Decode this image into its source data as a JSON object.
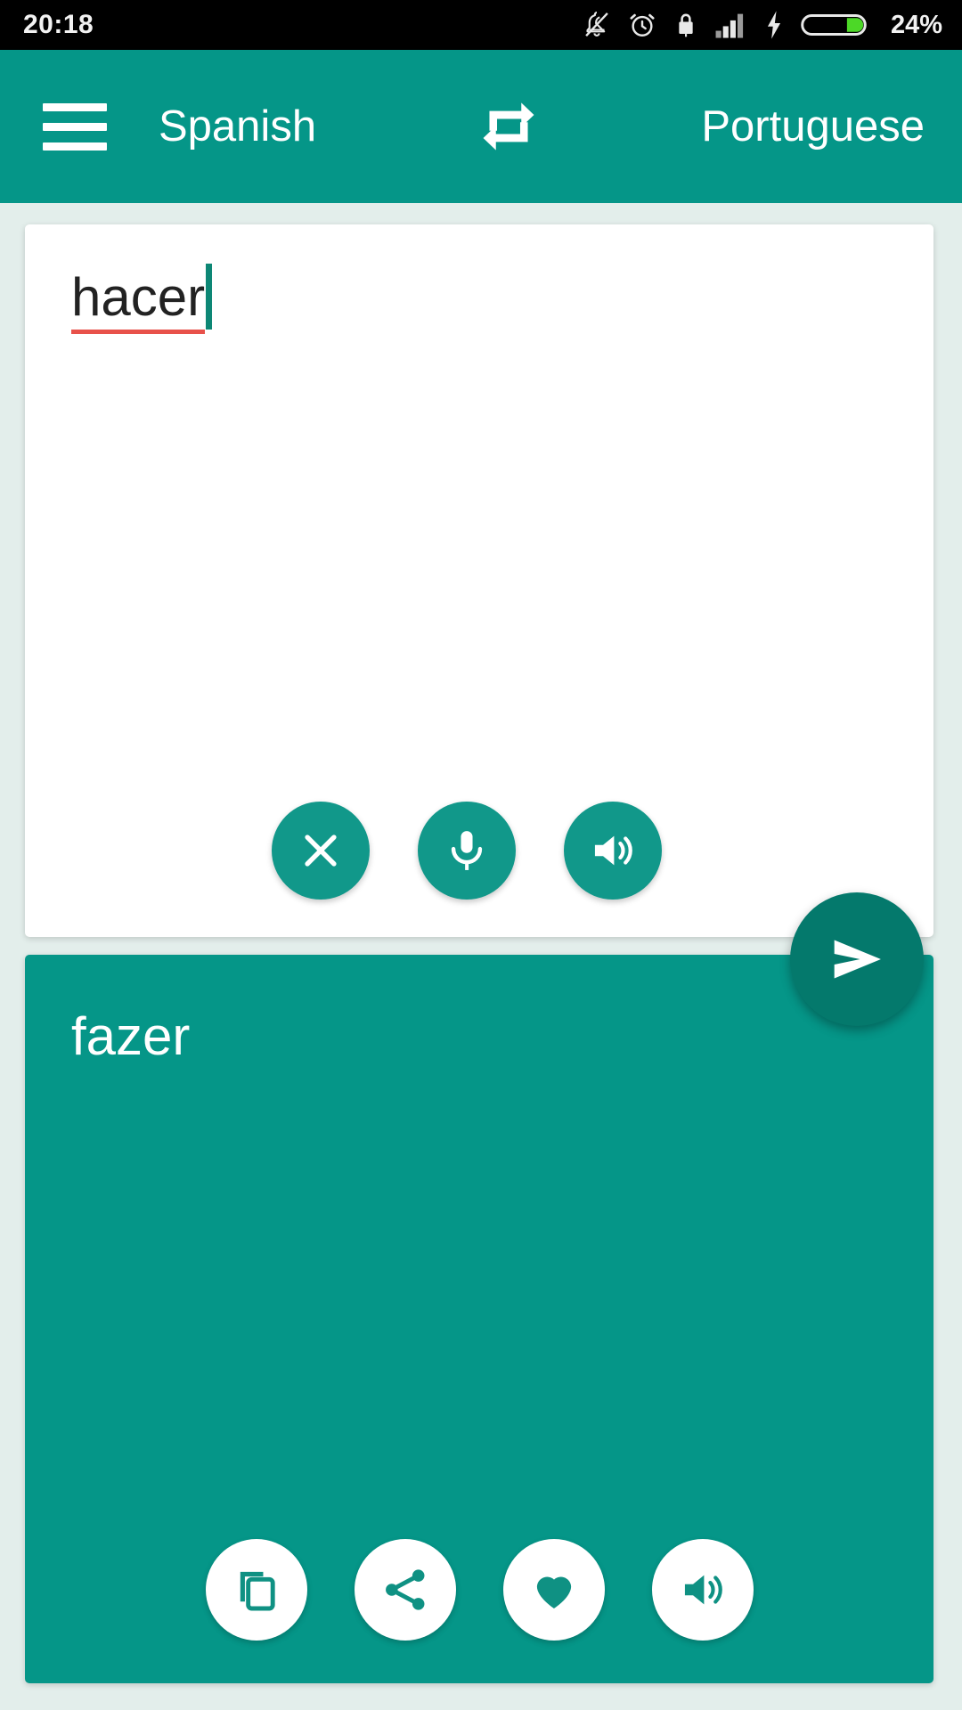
{
  "status_bar": {
    "time": "20:18",
    "battery_percent": "24%",
    "icons": [
      "bell-off-icon",
      "alarm-clock-icon",
      "lock-icon",
      "signal-bars-icon",
      "charging-bolt-icon",
      "battery-icon"
    ],
    "battery_fill_color": "#4cd827",
    "background": "#000000",
    "text_color": "#f2f2f2"
  },
  "app_bar": {
    "menu_icon": "hamburger-menu-icon",
    "source_language": "Spanish",
    "swap_icon": "swap-languages-icon",
    "target_language": "Portuguese",
    "background": "#059688"
  },
  "input_panel": {
    "text": "hacer",
    "spellcheck_underline_color": "#e8514a",
    "caret_color": "#0d8775",
    "background": "#ffffff",
    "actions": [
      {
        "name": "clear-button",
        "icon": "close-x-icon",
        "label": "Clear"
      },
      {
        "name": "voice-input-button",
        "icon": "microphone-icon",
        "label": "Voice input"
      },
      {
        "name": "speak-source-button",
        "icon": "speaker-icon",
        "label": "Listen"
      }
    ]
  },
  "send_button": {
    "icon": "send-icon",
    "label": "Translate",
    "color": "#04796c"
  },
  "output_panel": {
    "text": "fazer",
    "background": "#059688",
    "text_color": "#ffffff",
    "actions": [
      {
        "name": "copy-button",
        "icon": "copy-icon",
        "label": "Copy"
      },
      {
        "name": "share-button",
        "icon": "share-icon",
        "label": "Share"
      },
      {
        "name": "favorite-button",
        "icon": "heart-icon",
        "label": "Favorite"
      },
      {
        "name": "speak-result-button",
        "icon": "speaker-icon",
        "label": "Listen"
      }
    ]
  },
  "theme": {
    "page_background": "#e3eeeb",
    "primary": "#059688",
    "primary_dark": "#04796c"
  }
}
